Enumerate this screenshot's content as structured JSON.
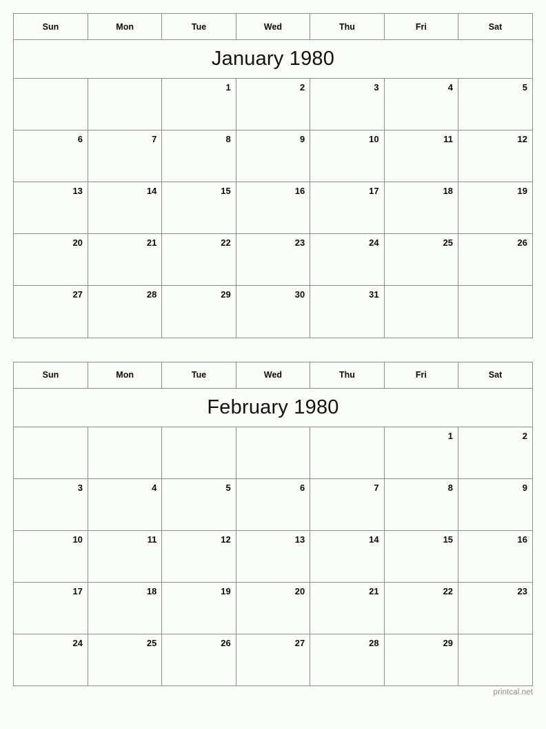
{
  "site": {
    "footer_label": "printcal.net"
  },
  "weekday_headers": [
    "Sun",
    "Mon",
    "Tue",
    "Wed",
    "Thu",
    "Fri",
    "Sat"
  ],
  "calendars": [
    {
      "title": "January 1980",
      "month": "January",
      "year": "1980",
      "weeks": [
        [
          "",
          "",
          "1",
          "2",
          "3",
          "4",
          "5"
        ],
        [
          "6",
          "7",
          "8",
          "9",
          "10",
          "11",
          "12"
        ],
        [
          "13",
          "14",
          "15",
          "16",
          "17",
          "18",
          "19"
        ],
        [
          "20",
          "21",
          "22",
          "23",
          "24",
          "25",
          "26"
        ],
        [
          "27",
          "28",
          "29",
          "30",
          "31",
          "",
          ""
        ]
      ]
    },
    {
      "title": "February 1980",
      "month": "February",
      "year": "1980",
      "weeks": [
        [
          "",
          "",
          "",
          "",
          "",
          "1",
          "2"
        ],
        [
          "3",
          "4",
          "5",
          "6",
          "7",
          "8",
          "9"
        ],
        [
          "10",
          "11",
          "12",
          "13",
          "14",
          "15",
          "16"
        ],
        [
          "17",
          "18",
          "19",
          "20",
          "21",
          "22",
          "23"
        ],
        [
          "24",
          "25",
          "26",
          "27",
          "28",
          "29",
          ""
        ]
      ]
    }
  ]
}
